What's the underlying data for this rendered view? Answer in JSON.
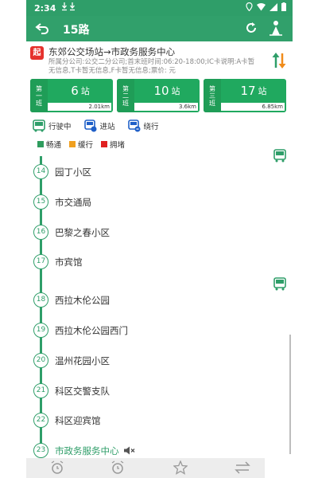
{
  "statusbar": {
    "time": "2:34"
  },
  "header": {
    "title": "15路"
  },
  "route": {
    "start_badge": "起",
    "name": "东郊公交场站→市政务服务中心",
    "description": "所属分公司:公交二分公司;首末班时间:06:20-18:00;IC卡说明:A卡暂无信息,T卡暂无信息,F卡暂无信息;票价: 元"
  },
  "buses": [
    {
      "order": [
        "第",
        "一",
        "班"
      ],
      "stops_num": "6",
      "unit": "站",
      "distance": "2.01km"
    },
    {
      "order": [
        "第",
        "二",
        "班"
      ],
      "stops_num": "10",
      "unit": "站",
      "distance": "3.6km"
    },
    {
      "order": [
        "第",
        "三",
        "班"
      ],
      "stops_num": "17",
      "unit": "站",
      "distance": "6.85km"
    }
  ],
  "legend_bus": [
    {
      "label": "行驶中",
      "icon": "bus-running-icon"
    },
    {
      "label": "进站",
      "icon": "bus-arriving-icon"
    },
    {
      "label": "绕行",
      "icon": "bus-detour-icon"
    }
  ],
  "legend_traffic": [
    {
      "label": "畅通",
      "color": "#2e9c5e"
    },
    {
      "label": "缓行",
      "color": "#f0a020"
    },
    {
      "label": "拥堵",
      "color": "#e02020"
    }
  ],
  "stops": [
    {
      "num": "14",
      "name": "园丁小区"
    },
    {
      "num": "15",
      "name": "市交通局"
    },
    {
      "num": "16",
      "name": "巴黎之春小区"
    },
    {
      "num": "17",
      "name": "市宾馆"
    },
    {
      "num": "18",
      "name": "西拉木伦公园"
    },
    {
      "num": "19",
      "name": "西拉木伦公园西门"
    },
    {
      "num": "20",
      "name": "温州花园小区"
    },
    {
      "num": "21",
      "name": "科区交警支队"
    },
    {
      "num": "22",
      "name": "科区迎宾馆"
    },
    {
      "num": "23",
      "name": "市政务服务中心"
    }
  ],
  "colors": {
    "primary": "#2f9e69",
    "card": "#20a95f",
    "start_badge": "#e5322d"
  }
}
